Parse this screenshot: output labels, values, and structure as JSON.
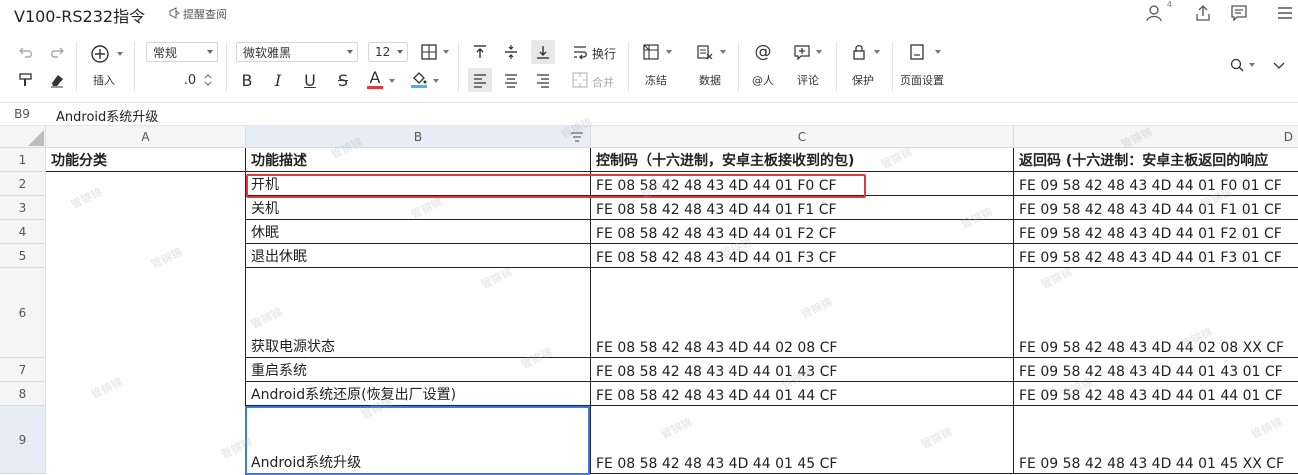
{
  "title": "V100-RS232指令",
  "reminder": "提醒查阅",
  "notification_count": "4",
  "toolbar": {
    "insert": "插入",
    "format_normal": "常规",
    "decimal": ".0",
    "font": "微软雅黑",
    "font_size": "12",
    "bold": "B",
    "italic": "I",
    "underline": "U",
    "strike": "S",
    "font_color": "A",
    "wrap": "换行",
    "merge": "合并",
    "freeze": "冻结",
    "data": "数据",
    "mention": "@人",
    "comment": "评论",
    "protect": "保护",
    "page_setup": "页面设置"
  },
  "formula_bar": {
    "cell_ref": "B9",
    "value": "Android系统升级"
  },
  "watermark": "管锦锦",
  "grid": {
    "columns": [
      "A",
      "B",
      "C",
      "D"
    ],
    "rows": [
      {
        "num": "1",
        "a": "功能分类",
        "b": "功能描述",
        "c": "控制码（十六进制，安卓主板接收到的包)",
        "d": "返回码 (十六进制：安卓主板返回的响应"
      },
      {
        "num": "2",
        "a": "",
        "b": "开机",
        "c": "FE 08 58 42 48 43 4D 44 01 F0 CF",
        "d": "FE 09 58 42 48 43 4D 44 01 F0 01 CF"
      },
      {
        "num": "3",
        "a": "",
        "b": "关机",
        "c": "FE 08 58 42 48 43 4D 44 01 F1 CF",
        "d": "FE 09 58 42 48 43 4D 44 01 F1 01 CF"
      },
      {
        "num": "4",
        "a": "",
        "b": "休眠",
        "c": "FE 08 58 42 48 43 4D 44 01 F2 CF",
        "d": "FE 09 58 42 48 43 4D 44 01 F2 01 CF"
      },
      {
        "num": "5",
        "a": "",
        "b": "退出休眠",
        "c": "FE 08 58 42 48 43 4D 44 01 F3 CF",
        "d": "FE 09 58 42 48 43 4D 44 01 F3 01 CF"
      },
      {
        "num": "6",
        "a": "",
        "b": "获取电源状态",
        "c": "FE 08 58 42 48 43 4D 44 02 08 CF",
        "d": "FE 09 58 42 48 43 4D 44  02 08 XX CF"
      },
      {
        "num": "7",
        "a": "",
        "b": "重启系统",
        "c": "FE 08 58 42 48 43 4D 44 01 43 CF",
        "d": "FE 09 58 42 48 43 4D 44 01 43 01 CF"
      },
      {
        "num": "8",
        "a": "",
        "b": "Android系统还原(恢复出厂设置)",
        "c": "FE 08 58 42 48 43 4D 44 01 44 CF",
        "d": "FE 09 58 42 48 43 4D 44 01 44 01 CF"
      },
      {
        "num": "9",
        "a": "",
        "b": "Android系统升级",
        "c": "FE 08 58 42 48 43 4D 44 01 45 CF",
        "d": "FE 09 58 42 48 43 4D 44 01 45 XX CF"
      }
    ]
  }
}
